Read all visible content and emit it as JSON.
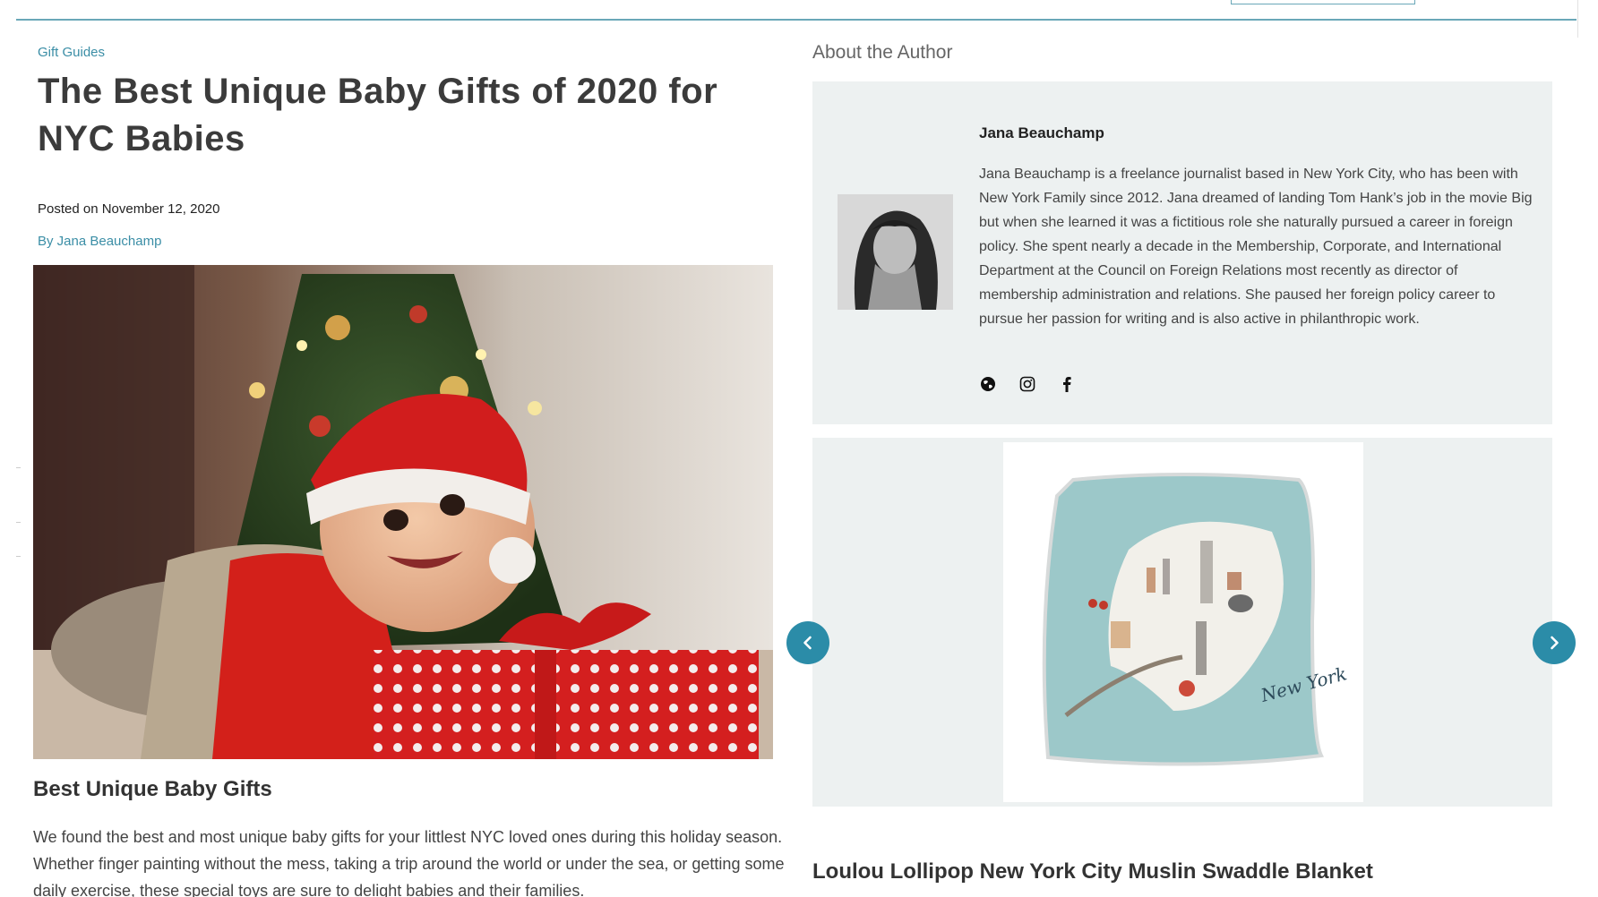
{
  "article": {
    "category": "Gift Guides",
    "title": "The Best Unique Baby Gifts of 2020 for NYC Babies",
    "posted": "Posted on November 12, 2020",
    "byline": "By Jana Beauchamp",
    "section_heading": "Best Unique Baby Gifts",
    "body": "We found the best and most unique baby gifts for your littlest NYC loved ones during this holiday season. Whether finger painting without the mess, taking a trip around the world or under the sea, or getting some daily exercise, these special toys are sure to delight babies and their families."
  },
  "sidebar": {
    "about_label": "About the Author",
    "author_name": "Jana Beauchamp",
    "author_bio": "Jana Beauchamp is a freelance journalist based in New York City, who has been with New York Family since 2012. Jana dreamed of landing Tom Hank’s job in the movie Big but when she learned it was a fictitious role she naturally pursued a career in foreign policy. She spent nearly a decade in the Membership, Corporate, and International Department at the Council on Foreign Relations most recently as director of membership administration and relations. She paused her foreign policy career to pursue her passion for writing and is also active in philanthropic work.",
    "social_icons": [
      "globe-icon",
      "instagram-icon",
      "facebook-icon"
    ],
    "product_title": "Loulou Lollipop New York City Muslin Swaddle Blanket",
    "blanket_caption": "New York"
  },
  "colors": {
    "accent": "#2b8ca8",
    "link": "#3b8ea6",
    "panel": "#edf1f1"
  }
}
